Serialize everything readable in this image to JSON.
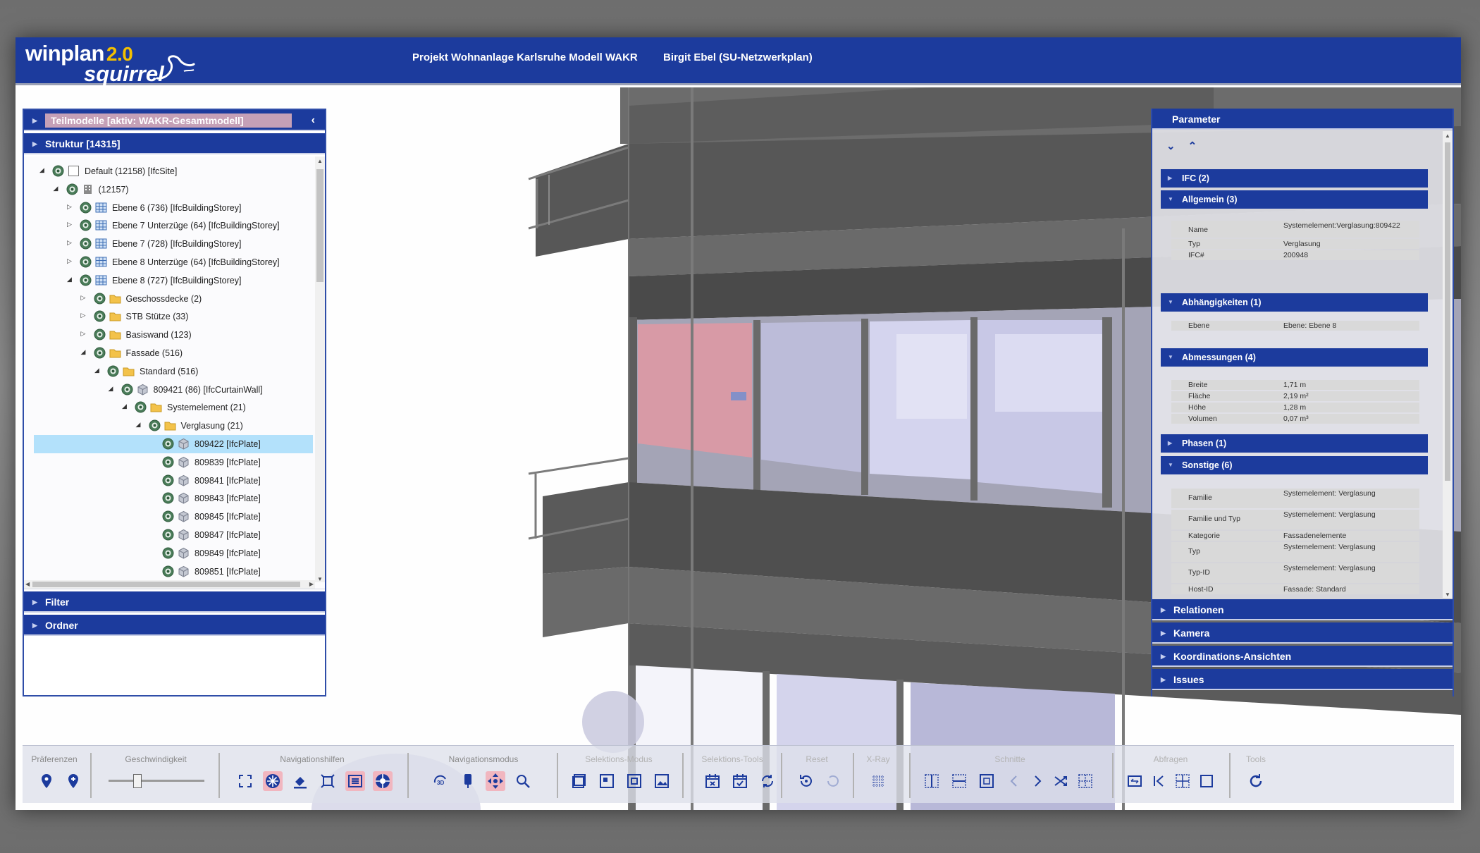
{
  "header": {
    "logo_main": "winplan",
    "logo_version": "2.0",
    "logo_sub": "squirrel",
    "project": "Projekt Wohnanlage Karlsruhe Modell WAKR",
    "user": "Birgit Ebel (SU-Netzwerkplan)"
  },
  "left_panel": {
    "teilmodelle": "Teilmodelle [aktiv: WAKR-Gesamtmodell]",
    "struktur": "Struktur [14315]",
    "tree": [
      {
        "label": "Default (12158) [IfcSite]"
      },
      {
        "label": "(12157)"
      },
      {
        "label": "Ebene 6 (736) [IfcBuildingStorey]"
      },
      {
        "label": "Ebene 7 Unterzüge (64) [IfcBuildingStorey]"
      },
      {
        "label": "Ebene 7 (728) [IfcBuildingStorey]"
      },
      {
        "label": "Ebene 8 Unterzüge (64) [IfcBuildingStorey]"
      },
      {
        "label": "Ebene 8 (727) [IfcBuildingStorey]"
      },
      {
        "label": "Geschossdecke (2)"
      },
      {
        "label": "STB Stütze (33)"
      },
      {
        "label": "Basiswand (123)"
      },
      {
        "label": "Fassade (516)"
      },
      {
        "label": "Standard (516)"
      },
      {
        "label": "809421 (86) [IfcCurtainWall]"
      },
      {
        "label": "Systemelement (21)"
      },
      {
        "label": "Verglasung (21)"
      },
      {
        "label": "809422 [IfcPlate]"
      },
      {
        "label": "809839 [IfcPlate]"
      },
      {
        "label": "809841 [IfcPlate]"
      },
      {
        "label": "809843 [IfcPlate]"
      },
      {
        "label": "809845 [IfcPlate]"
      },
      {
        "label": "809847 [IfcPlate]"
      },
      {
        "label": "809849 [IfcPlate]"
      },
      {
        "label": "809851 [IfcPlate]"
      }
    ],
    "filter": "Filter",
    "ordner": "Ordner"
  },
  "right_panel": {
    "parameter": "Parameter",
    "sections": {
      "ifc": "IFC (2)",
      "allgemein": "Allgemein (3)",
      "abhaengigkeiten": "Abhängigkeiten (1)",
      "abmessungen": "Abmessungen (4)",
      "phasen": "Phasen (1)",
      "sonstige": "Sonstige (6)"
    },
    "allgemein_props": [
      {
        "k": "Name",
        "v": "Systemelement:Verglasung:809422"
      },
      {
        "k": "Typ",
        "v": "Verglasung"
      },
      {
        "k": "IFC#",
        "v": "200948"
      }
    ],
    "abhaengigkeiten_props": [
      {
        "k": "Ebene",
        "v": "Ebene: Ebene 8"
      }
    ],
    "abmessungen_props": [
      {
        "k": "Breite",
        "v": "1,71 m"
      },
      {
        "k": "Fläche",
        "v": "2,19 m²"
      },
      {
        "k": "Höhe",
        "v": "1,28 m"
      },
      {
        "k": "Volumen",
        "v": "0,07 m³"
      }
    ],
    "sonstige_props": [
      {
        "k": "Familie",
        "v": "Systemelement: Verglasung"
      },
      {
        "k": "Familie und Typ",
        "v": "Systemelement: Verglasung"
      },
      {
        "k": "Kategorie",
        "v": "Fassadenelemente"
      },
      {
        "k": "Typ",
        "v": "Systemelement: Verglasung"
      },
      {
        "k": "Typ-ID",
        "v": "Systemelement: Verglasung"
      },
      {
        "k": "Host-ID",
        "v": "Fassade: Standard"
      }
    ],
    "relationen": "Relationen",
    "kamera": "Kamera",
    "koordinations": "Koordinations-Ansichten",
    "issues": "Issues"
  },
  "toolbar": {
    "praeferenzen": "Präferenzen",
    "geschwindigkeit": "Geschwindigkeit",
    "navigationshilfen": "Navigationshilfen",
    "navigationsmodus": "Navigationsmodus",
    "selektions_modus": "Selektions-Modus",
    "selektions_tools": "Selektions-Tools",
    "reset": "Reset",
    "xray": "X-Ray",
    "schnitte": "Schnitte",
    "abfragen": "Abfragen",
    "tools": "Tools",
    "speed_level": 0.3
  },
  "colors": {
    "brand_blue": "#1c3b9d",
    "selection_row": "#b3e1fb",
    "active_tool": "#f1b6bf",
    "highlight_pane": "#d89aa6",
    "logo_accent": "#f4c000"
  }
}
